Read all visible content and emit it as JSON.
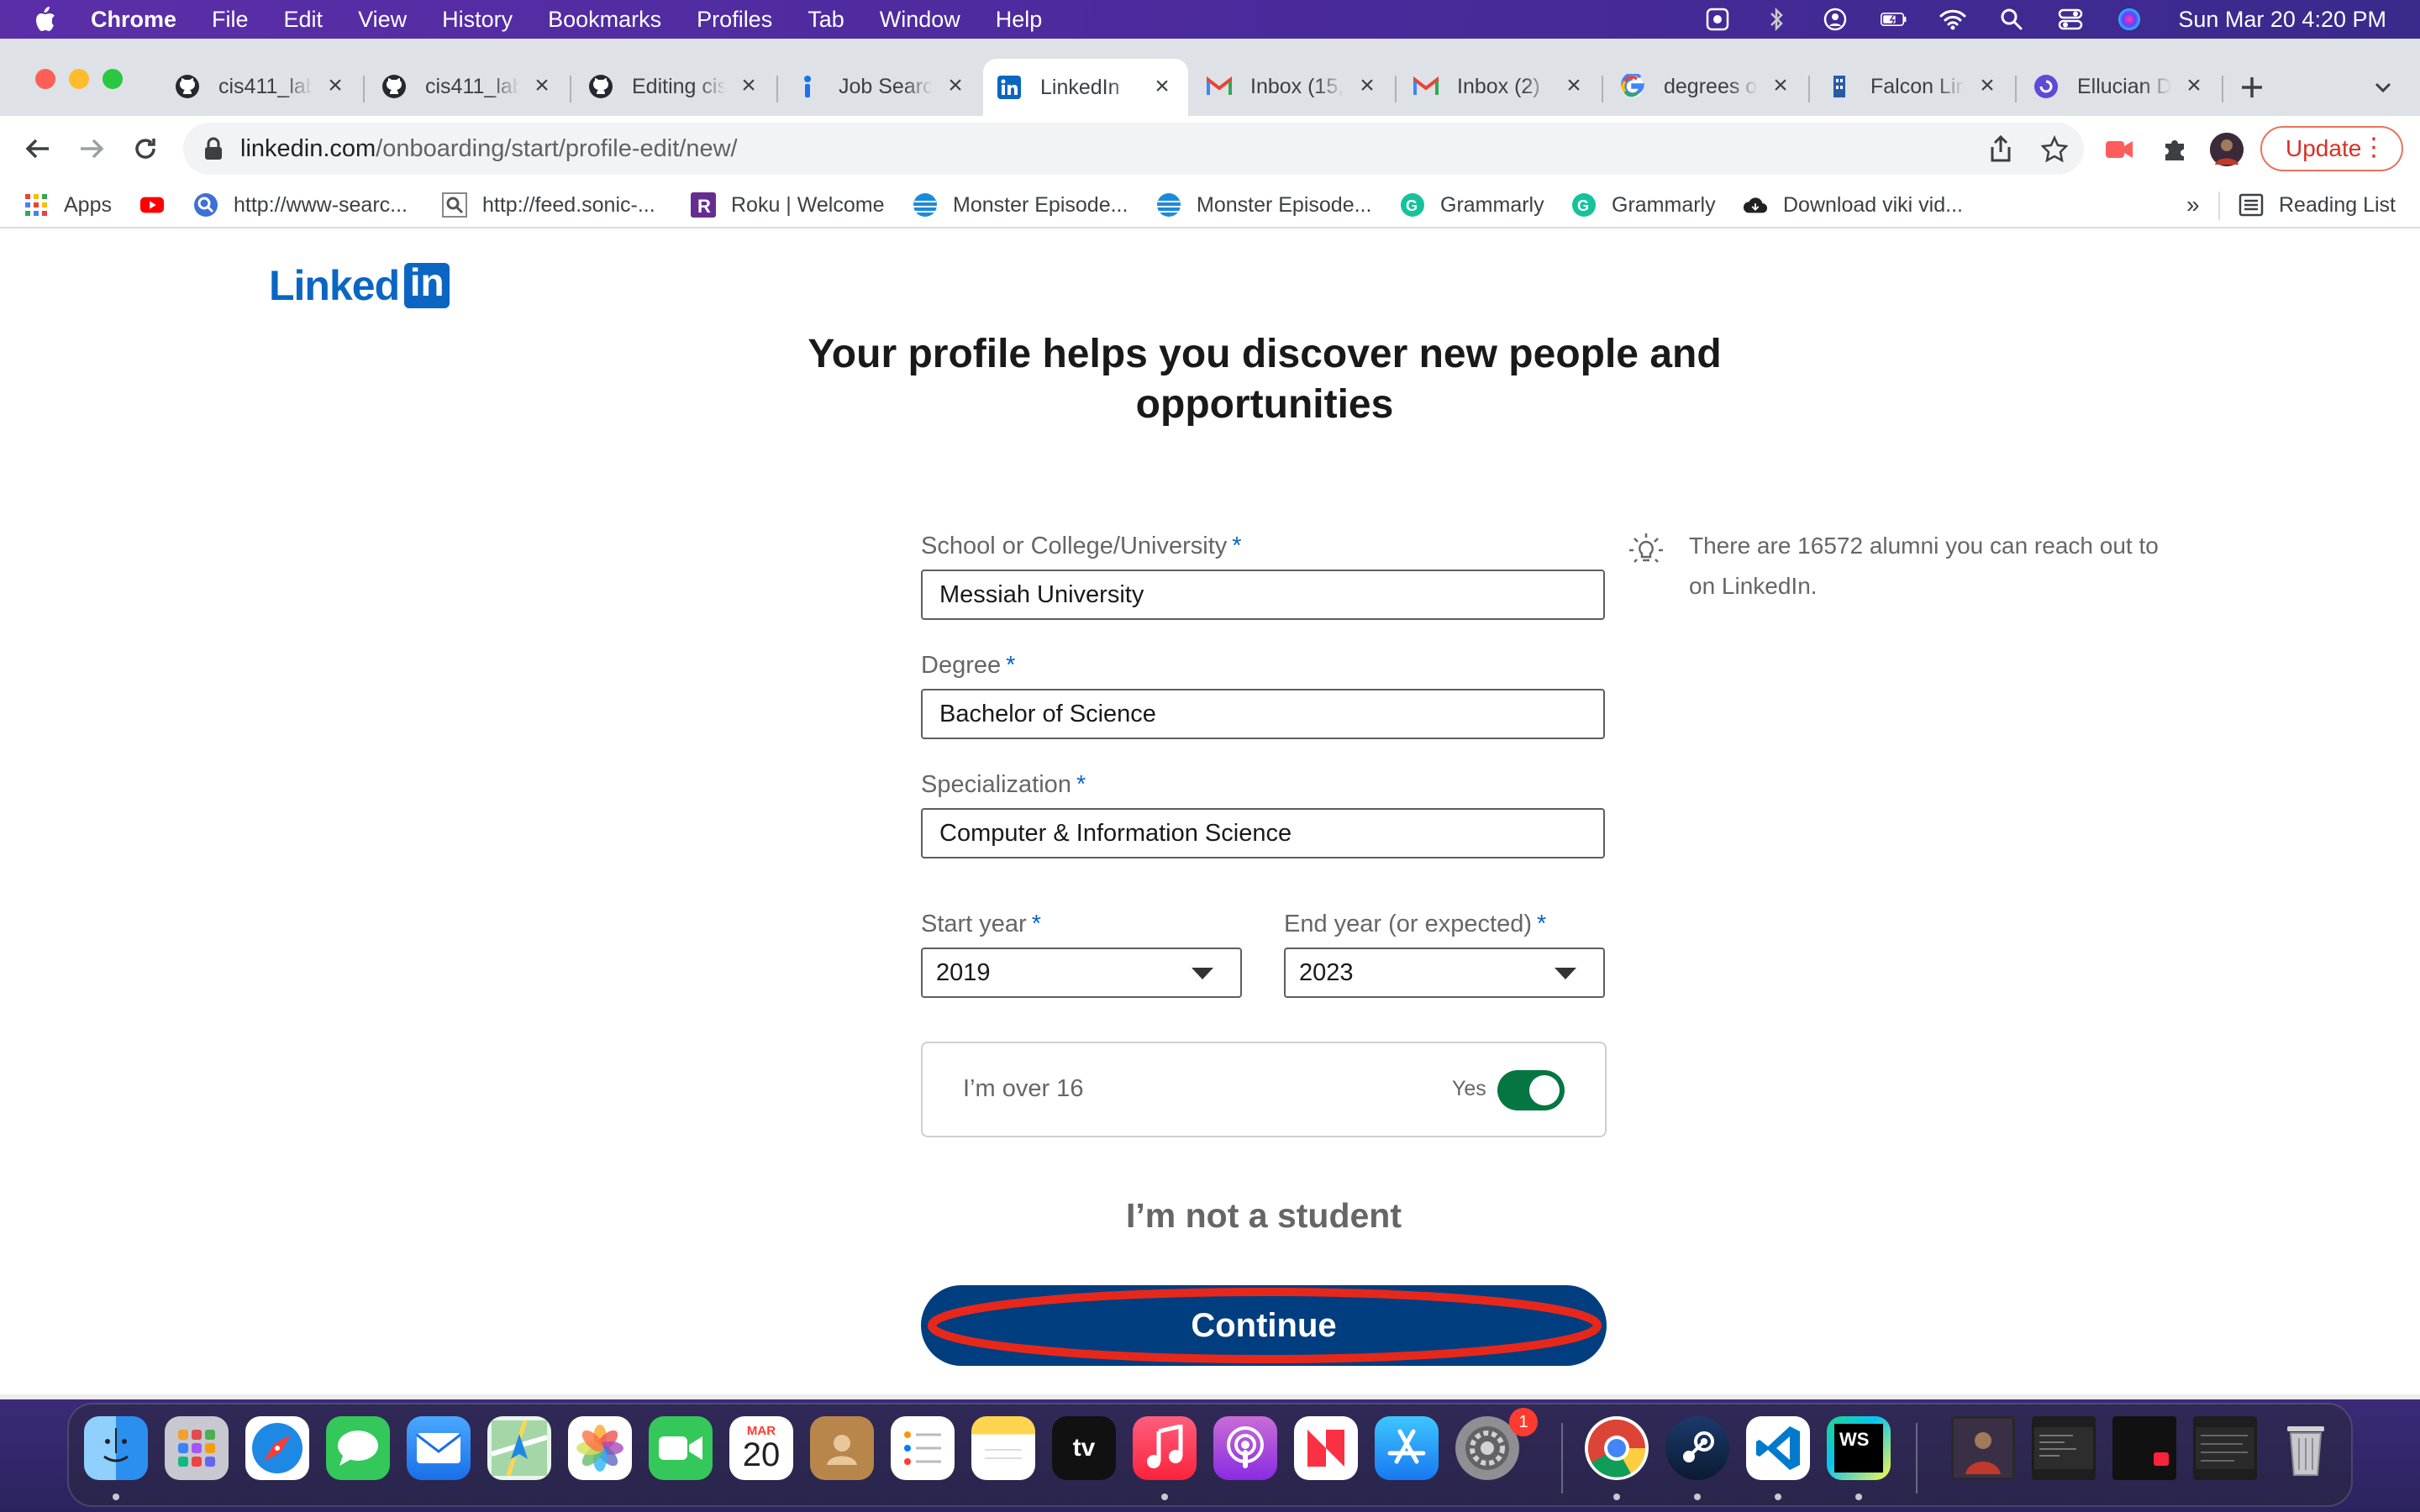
{
  "menubar": {
    "app_name": "Chrome",
    "items": [
      "File",
      "Edit",
      "View",
      "History",
      "Bookmarks",
      "Profiles",
      "Tab",
      "Window",
      "Help"
    ],
    "clock": "Sun Mar 20  4:20 PM"
  },
  "tabs": [
    {
      "label": "cis411_lab",
      "icon": "github-icon"
    },
    {
      "label": "cis411_lab",
      "icon": "github-icon"
    },
    {
      "label": "Editing cis",
      "icon": "github-icon"
    },
    {
      "label": "Job Search",
      "icon": "info-icon"
    },
    {
      "label": "LinkedIn",
      "icon": "linkedin-icon",
      "active": true
    },
    {
      "label": "Inbox (15,",
      "icon": "gmail-icon"
    },
    {
      "label": "Inbox (2)",
      "icon": "gmail-icon"
    },
    {
      "label": "degrees o",
      "icon": "google-icon"
    },
    {
      "label": "Falcon Lin",
      "icon": "falcon-icon"
    },
    {
      "label": "Ellucian D",
      "icon": "ellucian-icon"
    }
  ],
  "address": {
    "domain": "linkedin.com",
    "path": "/onboarding/start/profile-edit/new/"
  },
  "toolbar": {
    "update_label": "Update"
  },
  "bookmarks": [
    {
      "label": "Apps",
      "icon": "apps-grid-icon"
    },
    {
      "label": "",
      "icon": "youtube-icon"
    },
    {
      "label": "http://www-searc...",
      "icon": "search-globe-icon"
    },
    {
      "label": "http://feed.sonic-...",
      "icon": "magnifier-page-icon"
    },
    {
      "label": "Roku | Welcome",
      "icon": "roku-icon"
    },
    {
      "label": "Monster Episode...",
      "icon": "att-globe-icon"
    },
    {
      "label": "Monster Episode...",
      "icon": "att-globe-icon"
    },
    {
      "label": "Grammarly",
      "icon": "grammarly-icon"
    },
    {
      "label": "Grammarly",
      "icon": "grammarly-icon"
    },
    {
      "label": "Download viki vid...",
      "icon": "cloud-icon"
    }
  ],
  "reading_list_label": "Reading List",
  "page": {
    "logo_text": "Linked",
    "logo_in": "in",
    "headline": "Your profile helps you discover new people and opportunities",
    "school": {
      "label": "School or College/University",
      "value": "Messiah University"
    },
    "degree": {
      "label": "Degree",
      "value": "Bachelor of Science"
    },
    "specialization": {
      "label": "Specialization",
      "value": "Computer & Information Science"
    },
    "start_year": {
      "label": "Start year",
      "value": "2019"
    },
    "end_year": {
      "label": "End year (or expected)",
      "value": "2023"
    },
    "required_marker": "*",
    "hint": "There are 16572 alumni you can reach out to on LinkedIn.",
    "over16": {
      "label": "I’m over 16",
      "toggle_text": "Yes",
      "checked": true
    },
    "not_student": "I’m not a student",
    "continue_label": "Continue"
  },
  "colors": {
    "linkedin_blue": "#0a66c2",
    "continue_bg": "#003e7f",
    "toggle_on": "#057642",
    "annotation_ring": "#e8271b"
  },
  "dock": {
    "apps": [
      "Finder",
      "Launchpad",
      "Safari",
      "Messages",
      "Mail",
      "Maps",
      "Photos",
      "FaceTime",
      "Calendar",
      "Contacts",
      "Reminders",
      "Notes",
      "TV",
      "Music",
      "Podcasts",
      "News",
      "App Store",
      "System Preferences",
      "Chrome",
      "Steam",
      "Visual Studio Code",
      "WebStorm"
    ],
    "calendar_month": "MAR",
    "calendar_day": "20",
    "tv_label": "tv",
    "ws_label": "WS",
    "sysprefs_badge": "1"
  }
}
